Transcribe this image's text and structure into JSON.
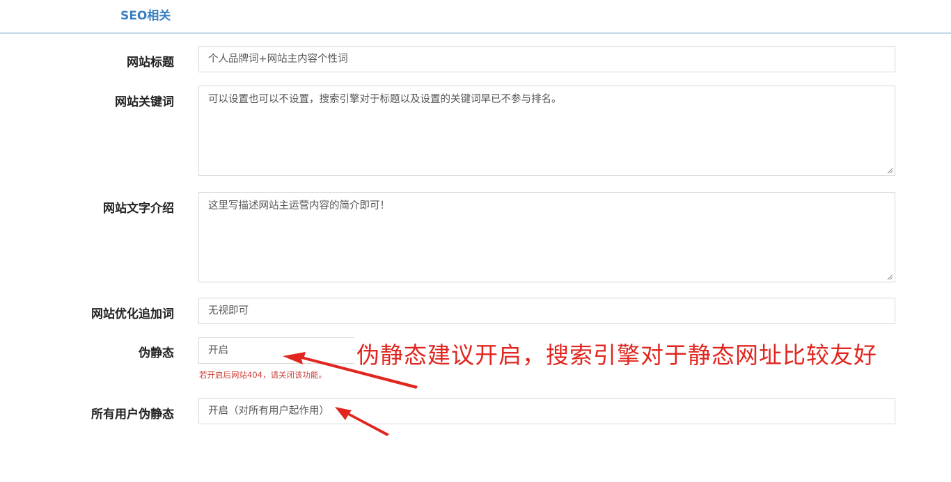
{
  "section": {
    "title": "SEO相关"
  },
  "form": {
    "site_title": {
      "label": "网站标题",
      "value": "个人品牌词+网站主内容个性词"
    },
    "site_keywords": {
      "label": "网站关键词",
      "value": "可以设置也可以不设置，搜索引擎对于标题以及设置的关键词早已不参与排名。"
    },
    "site_description": {
      "label": "网站文字介绍",
      "value": "这里写描述网站主运营内容的简介即可！"
    },
    "seo_append_words": {
      "label": "网站优化追加词",
      "value": "无视即可"
    },
    "pseudo_static": {
      "label": "伪静态",
      "value": "开启",
      "hint": "若开启后网站404，请关闭该功能。"
    },
    "all_users_pseudo_static": {
      "label": "所有用户伪静态",
      "value": "开启（对所有用户起作用）"
    }
  },
  "annotation": {
    "text": "伪静态建议开启，搜索引擎对于静态网址比较友好",
    "color": "#e0261f"
  },
  "colors": {
    "accent": "#3a7fc1",
    "border": "#d8d8d8",
    "hint": "#c9413a"
  }
}
